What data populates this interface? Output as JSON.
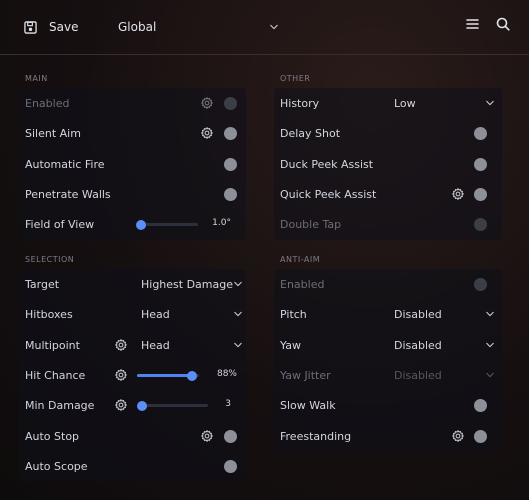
{
  "topbar": {
    "save_label": "Save",
    "config_label": "Global"
  },
  "sections": {
    "main": "MAIN",
    "other": "OTHER",
    "selection": "SELECTION",
    "anti_aim": "ANTI-AIM"
  },
  "main": {
    "enabled": "Enabled",
    "silent_aim": "Silent Aim",
    "automatic_fire": "Automatic Fire",
    "penetrate_walls": "Penetrate Walls",
    "field_of_view": "Field of View",
    "field_of_view_value": "1.0°",
    "field_of_view_fraction": 0.0
  },
  "other": {
    "history": "History",
    "history_value": "Low",
    "delay_shot": "Delay Shot",
    "duck_peek_assist": "Duck Peek Assist",
    "quick_peek_assist": "Quick Peek Assist",
    "double_tap": "Double Tap"
  },
  "selection": {
    "target": "Target",
    "target_value": "Highest Damage",
    "hitboxes": "Hitboxes",
    "hitboxes_value": "Head",
    "multipoint": "Multipoint",
    "multipoint_value": "Head",
    "hit_chance": "Hit Chance",
    "hit_chance_value": "88%",
    "hit_chance_fraction": 0.88,
    "min_damage": "Min Damage",
    "min_damage_value": "3",
    "min_damage_fraction": 0.03,
    "auto_stop": "Auto Stop",
    "auto_scope": "Auto Scope"
  },
  "anti_aim": {
    "enabled": "Enabled",
    "pitch": "Pitch",
    "pitch_value": "Disabled",
    "yaw": "Yaw",
    "yaw_value": "Disabled",
    "yaw_jitter": "Yaw Jitter",
    "yaw_jitter_value": "Disabled",
    "slow_walk": "Slow Walk",
    "freestanding": "Freestanding"
  },
  "colors": {
    "accent": "#4e84f1",
    "toggle_off": "#8d8f99"
  }
}
